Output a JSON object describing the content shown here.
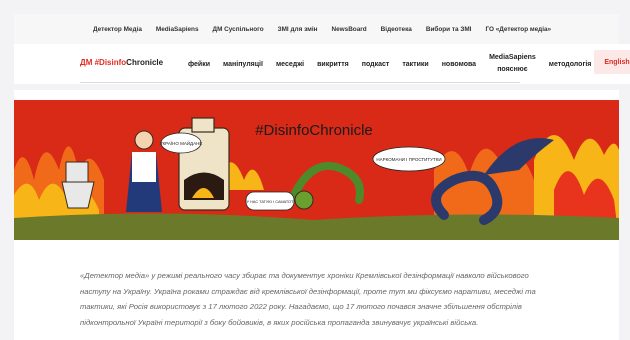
{
  "network": {
    "links": [
      "Детектор Медіа",
      "MediaSapiens",
      "ДМ Суспільного",
      "ЗМІ для змін",
      "NewsBoard",
      "Відеотека",
      "Вибори та ЗМІ",
      "ГО «Детектор медіа»"
    ]
  },
  "logo": {
    "prefix": "ДМ",
    "hashtag": "#Disinfo",
    "rest": "Chronicle"
  },
  "nav": {
    "items": [
      "фейки",
      "маніпуляції",
      "меседжі",
      "викриття",
      "подкаст",
      "тактики",
      "новомова"
    ],
    "special_line1": "MediaSapiens",
    "special_line2": "пояснює",
    "last": "методологія",
    "english": "English"
  },
  "hero": {
    "hashtag": "#DisinfoChronicle",
    "bubble1": "УКРАЇНО МАЙДАНЕ",
    "bubble2": "НАРКОМАНИ І ПРОСТИТУТКИ",
    "bubble3": "У НАС ТАТУЮ І САМАТОТ",
    "colors": {
      "fire": "#e8341c",
      "sky": "#d92a17",
      "ground": "#6b7a2a",
      "flame": "#f7b518"
    }
  },
  "description": "«Детектор медіа» у режимі реального часу збирає та документує хроніки Кремлівської дезінформації навколо військового наступу на Україну. Україна роками страждає від кремлівської дезінформації, проте тут ми фіксуємо наративи, меседжі та тактики, які Росія використовує з 17 лютого 2022 року. Нагадаємо, що 17 лютого почався значне збільшення обстрілів підконтрольної Україні території з боку бойовиків, в яких російська пропаганда звинувачує українські війська."
}
